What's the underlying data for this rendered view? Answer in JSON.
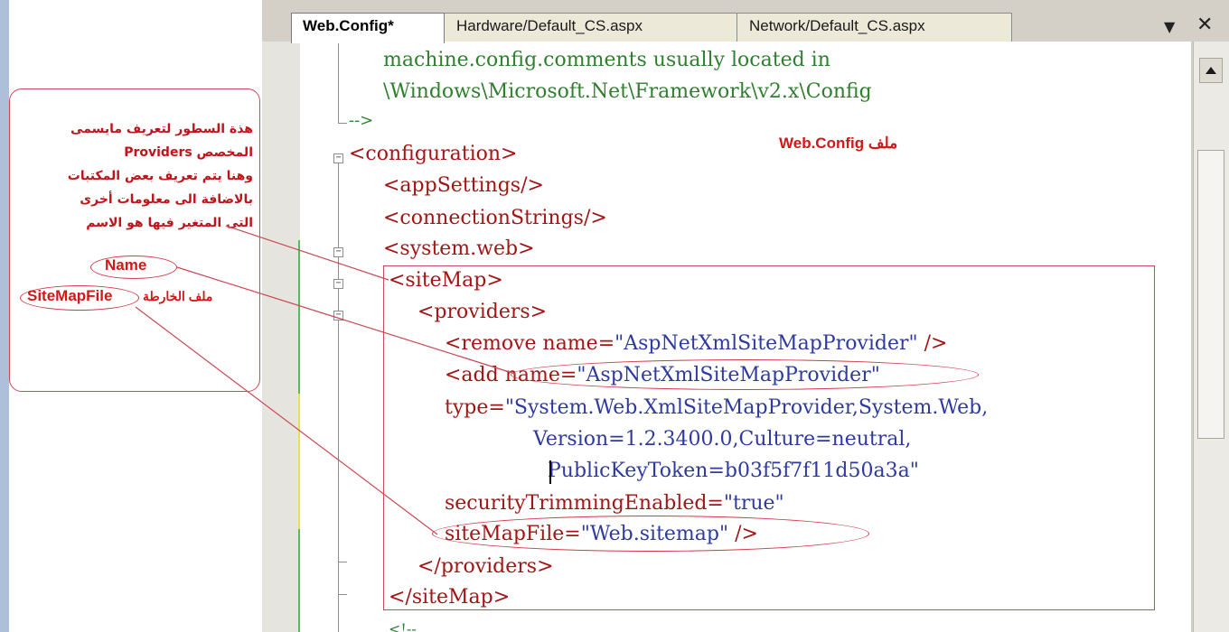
{
  "tabs": [
    {
      "label": "Web.Config*",
      "active": true
    },
    {
      "label": "Hardware/Default_CS.aspx",
      "active": false
    },
    {
      "label": "Network/Default_CS.aspx",
      "active": false
    }
  ],
  "tab_controls": {
    "menu_glyph": "▼",
    "close_glyph": "✕"
  },
  "code": {
    "comment_line1": "machine.config.comments usually located in",
    "comment_line2": "\\Windows\\Microsoft.Net\\Framework\\v2.x\\Config",
    "comment_end": "-->",
    "configuration": "<configuration>",
    "appSettings": "<appSettings/>",
    "connectionStrings": "<connectionStrings/>",
    "system_web": "<system.web>",
    "siteMap_open": "<siteMap>",
    "providers_open": "<providers>",
    "remove_tag": "<remove",
    "remove_attr": " name=",
    "remove_value": "\"AspNetXmlSiteMapProvider\"",
    "remove_close": " />",
    "add_tag": "<add ",
    "add_attr": "name=",
    "add_value": "\"AspNetXmlSiteMapProvider\"",
    "type_attr": "type=",
    "type_value": "\"System.Web.XmlSiteMapProvider,System.Web,",
    "version_line": "Version=1.2.3400.0,Culture=neutral,",
    "token_line": "PublicKeyToken=b03f5f7f11d50a3a\"",
    "security_attr": "securityTrimmingEnabled=",
    "security_value": "\"true\"",
    "sitemapfile_attr": "siteMapFile=",
    "sitemapfile_value": "\"Web.sitemap\"",
    "sitemapfile_close": " />",
    "providers_close": "</providers>",
    "siteMap_close": "</siteMap>",
    "next_comment": "<!--"
  },
  "annotations": {
    "title": "ملف Web.Config",
    "callout_lines": [
      "هذة السطور لتعريف مايسمى",
      "المخصص Providers",
      "وهنا يتم تعريف بعض المكتبات",
      "بالاضافة الى معلومات أخرى",
      "التى المتغير فيها هو الاسم"
    ],
    "name_label": "Name",
    "sitemapfile_label": "SiteMapFile",
    "sitemapfile_caption": "ملف الخارطة"
  },
  "colors": {
    "annotation_red": "#d01818",
    "xml_tag": "#a31515",
    "xml_value": "#2e3a9f",
    "comment": "#2f7f2f"
  }
}
